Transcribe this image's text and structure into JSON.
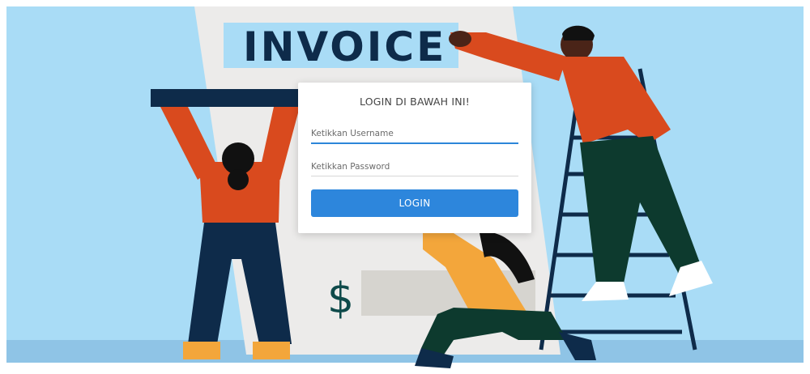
{
  "illustration": {
    "invoice_heading": "INVOICE",
    "currency_symbol": "$"
  },
  "login": {
    "title": "LOGIN DI BAWAH INI!",
    "username_placeholder": "Ketikkan Username",
    "password_placeholder": "Ketikkan Password",
    "button_label": "LOGIN"
  },
  "colors": {
    "sky": "#a9dcf6",
    "floor": "#8fc4e6",
    "paper": "#ecebea",
    "invoice_label_bg": "#a9dcf6",
    "navy": "#0e2b4a",
    "orange_shirt": "#d94a1e",
    "green_pants": "#0d3a2e",
    "yellow_shirt": "#f3a63b",
    "button_blue": "#2d86dc"
  }
}
